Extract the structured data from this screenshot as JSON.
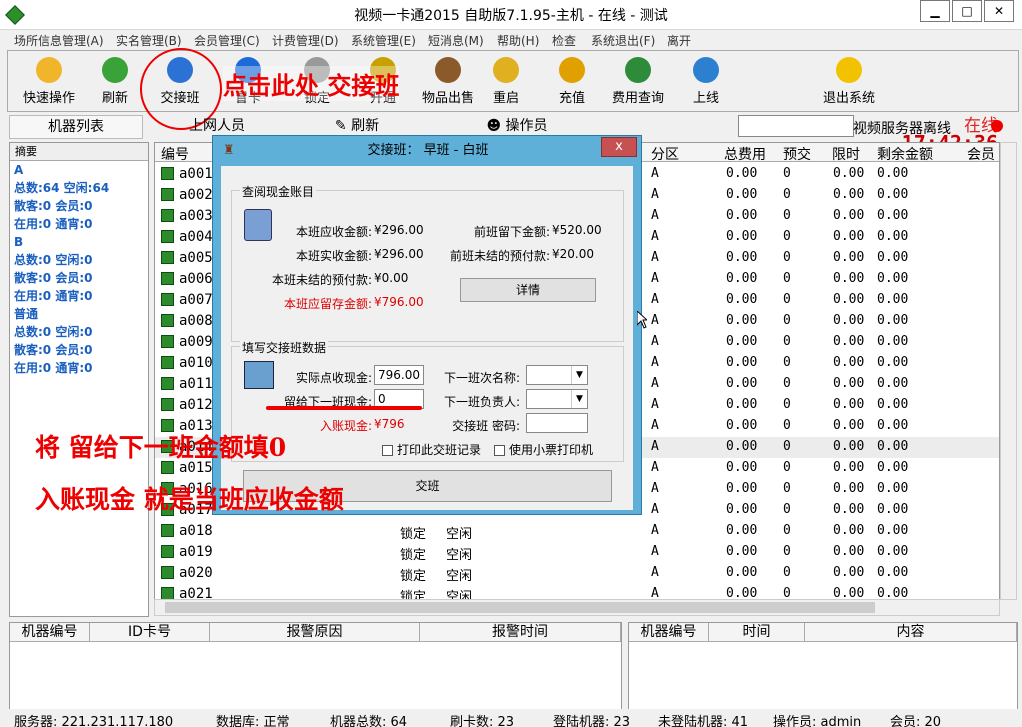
{
  "window": {
    "title": "视频一卡通2015 自助版7.1.95-主机 - 在线 - 测试",
    "min": "▁",
    "max": "□",
    "close": "✕"
  },
  "menu": [
    "场所信息管理(A)",
    "实名管理(B)",
    "会员管理(C)",
    "计费管理(D)",
    "系统管理(E)",
    "短消息(M)",
    "帮助(H)",
    "检查",
    "系统退出(F)",
    "离开"
  ],
  "toolbar": {
    "buttons": [
      {
        "label": "快速操作",
        "icon": "star-icon",
        "color": "#f1b52c"
      },
      {
        "label": "刷新",
        "icon": "refresh-icon",
        "color": "#39a339"
      },
      {
        "label": "交接班",
        "icon": "people-icon",
        "color": "#2c72d4"
      },
      {
        "label": "冒卡",
        "icon": "card-icon",
        "color": "#1c6bd8"
      },
      {
        "label": "锁定",
        "icon": "lock-icon",
        "color": "#999999"
      },
      {
        "label": "开通",
        "icon": "open-icon",
        "color": "#c8a000"
      },
      {
        "label": "物品出售",
        "icon": "goods-icon",
        "color": "#8b5a2b"
      },
      {
        "label": "重启",
        "icon": "restart-icon",
        "color": "#e0b020"
      },
      {
        "label": "充值",
        "icon": "recharge-icon",
        "color": "#e0a000"
      },
      {
        "label": "费用查询",
        "icon": "money-icon",
        "color": "#2e8b3a"
      },
      {
        "label": "上线",
        "icon": "globe-icon",
        "color": "#2d7fd0"
      },
      {
        "label": "退出系统",
        "icon": "exit-icon",
        "color": "#f2c200"
      }
    ],
    "status": "在线",
    "time": "17:42:36"
  },
  "annotations": {
    "click_here": "点击此处 交接班",
    "fill_zero": "将 留给下一班金额填0",
    "cash_is": "入账现金 就是当班应收金额"
  },
  "tabs": {
    "machines": "机器列表",
    "online": "上网人员",
    "refresh": "刷新",
    "operators": "操作员",
    "video_server": "视频服务器离线"
  },
  "summary": {
    "header": "摘要",
    "lines": [
      {
        "text": "A",
        "grp": true
      },
      {
        "text": "总数:64 空闲:64"
      },
      {
        "text": "散客:0 会员:0"
      },
      {
        "text": "在用:0 通宵:0"
      },
      {
        "text": "B",
        "grp": true
      },
      {
        "text": "总数:0 空闲:0"
      },
      {
        "text": "散客:0 会员:0"
      },
      {
        "text": "在用:0 通宵:0"
      },
      {
        "text": "普通",
        "grp": true
      },
      {
        "text": "总数:0 空闲:0"
      },
      {
        "text": "散客:0 会员:0"
      },
      {
        "text": "在用:0 通宵:0"
      }
    ]
  },
  "grid": {
    "headers": [
      "编号",
      "分区",
      "总费用",
      "预交",
      "限时",
      "剩余金额",
      "会员"
    ],
    "rows": [
      {
        "id": "a001",
        "state": "",
        "status": "",
        "zone": "A",
        "fee": "0.00",
        "pre": "0",
        "limit": "0.00",
        "rem": "0.00"
      },
      {
        "id": "a002",
        "state": "",
        "status": "",
        "zone": "A",
        "fee": "0.00",
        "pre": "0",
        "limit": "0.00",
        "rem": "0.00"
      },
      {
        "id": "a003",
        "state": "",
        "status": "",
        "zone": "A",
        "fee": "0.00",
        "pre": "0",
        "limit": "0.00",
        "rem": "0.00"
      },
      {
        "id": "a004",
        "state": "",
        "status": "",
        "zone": "A",
        "fee": "0.00",
        "pre": "0",
        "limit": "0.00",
        "rem": "0.00"
      },
      {
        "id": "a005",
        "state": "",
        "status": "",
        "zone": "A",
        "fee": "0.00",
        "pre": "0",
        "limit": "0.00",
        "rem": "0.00"
      },
      {
        "id": "a006",
        "state": "",
        "status": "",
        "zone": "A",
        "fee": "0.00",
        "pre": "0",
        "limit": "0.00",
        "rem": "0.00"
      },
      {
        "id": "a007",
        "state": "",
        "status": "",
        "zone": "A",
        "fee": "0.00",
        "pre": "0",
        "limit": "0.00",
        "rem": "0.00"
      },
      {
        "id": "a008",
        "state": "",
        "status": "",
        "zone": "A",
        "fee": "0.00",
        "pre": "0",
        "limit": "0.00",
        "rem": "0.00"
      },
      {
        "id": "a009",
        "state": "",
        "status": "",
        "zone": "A",
        "fee": "0.00",
        "pre": "0",
        "limit": "0.00",
        "rem": "0.00"
      },
      {
        "id": "a010",
        "state": "",
        "status": "",
        "zone": "A",
        "fee": "0.00",
        "pre": "0",
        "limit": "0.00",
        "rem": "0.00"
      },
      {
        "id": "a011",
        "state": "",
        "status": "",
        "zone": "A",
        "fee": "0.00",
        "pre": "0",
        "limit": "0.00",
        "rem": "0.00"
      },
      {
        "id": "a012",
        "state": "",
        "status": "",
        "zone": "A",
        "fee": "0.00",
        "pre": "0",
        "limit": "0.00",
        "rem": "0.00"
      },
      {
        "id": "a013",
        "state": "",
        "status": "",
        "zone": "A",
        "fee": "0.00",
        "pre": "0",
        "limit": "0.00",
        "rem": "0.00"
      },
      {
        "id": "a014",
        "state": "",
        "status": "",
        "zone": "A",
        "fee": "0.00",
        "pre": "0",
        "limit": "0.00",
        "rem": "0.00"
      },
      {
        "id": "a015",
        "state": "",
        "status": "",
        "zone": "A",
        "fee": "0.00",
        "pre": "0",
        "limit": "0.00",
        "rem": "0.00"
      },
      {
        "id": "a016",
        "state": "",
        "status": "",
        "zone": "A",
        "fee": "0.00",
        "pre": "0",
        "limit": "0.00",
        "rem": "0.00"
      },
      {
        "id": "a017",
        "state": "",
        "status": "",
        "zone": "A",
        "fee": "0.00",
        "pre": "0",
        "limit": "0.00",
        "rem": "0.00"
      },
      {
        "id": "a018",
        "state": "锁定",
        "status": "空闲",
        "zone": "A",
        "fee": "0.00",
        "pre": "0",
        "limit": "0.00",
        "rem": "0.00"
      },
      {
        "id": "a019",
        "state": "锁定",
        "status": "空闲",
        "zone": "A",
        "fee": "0.00",
        "pre": "0",
        "limit": "0.00",
        "rem": "0.00"
      },
      {
        "id": "a020",
        "state": "锁定",
        "status": "空闲",
        "zone": "A",
        "fee": "0.00",
        "pre": "0",
        "limit": "0.00",
        "rem": "0.00"
      },
      {
        "id": "a021",
        "state": "锁定",
        "status": "空闲",
        "zone": "A",
        "fee": "0.00",
        "pre": "0",
        "limit": "0.00",
        "rem": "0.00"
      }
    ]
  },
  "bottom_left_headers": [
    "机器编号",
    "ID卡号",
    "报警原因",
    "报警时间"
  ],
  "bottom_right_headers": [
    "机器编号",
    "时间",
    "内容"
  ],
  "statusbar": {
    "server": "服务器: 221.231.117.180",
    "db": "数据库: 正常",
    "total": "机器总数: 64",
    "cards": "刷卡数: 23",
    "logged": "登陆机器: 23",
    "notlogged": "未登陆机器: 41",
    "operator": "操作员: admin",
    "member": "会员: 20"
  },
  "dialog": {
    "title": "交接班： 早班 - 白班",
    "close": "x",
    "cash_group": "查阅现金账目",
    "receivable_label": "本班应收金额:",
    "receivable": "¥296.00",
    "prev_left_label": "前班留下金额:",
    "prev_left": "¥520.00",
    "actual_label": "本班实收金额:",
    "actual": "¥296.00",
    "prev_unsettled_label": "前班未结的预付款:",
    "prev_unsettled": "¥20.00",
    "unsettled_label": "本班未结的预付款:",
    "unsettled": "¥0.00",
    "retain_label": "本班应留存金额:",
    "retain": "¥796.00",
    "details": "详情",
    "fill_group": "填写交接班数据",
    "counted_label": "实际点收现金:",
    "counted": "796.00",
    "next_name_label": "下一班次名称:",
    "leave_label": "留给下一班现金:",
    "leave": "0",
    "next_person_label": "下一班负责人:",
    "deposit_label": "入账现金:",
    "deposit": "¥796",
    "password_label": "交接班 密码:",
    "print_record": "打印此交班记录",
    "use_receipt": "使用小票打印机",
    "submit": "交班"
  }
}
